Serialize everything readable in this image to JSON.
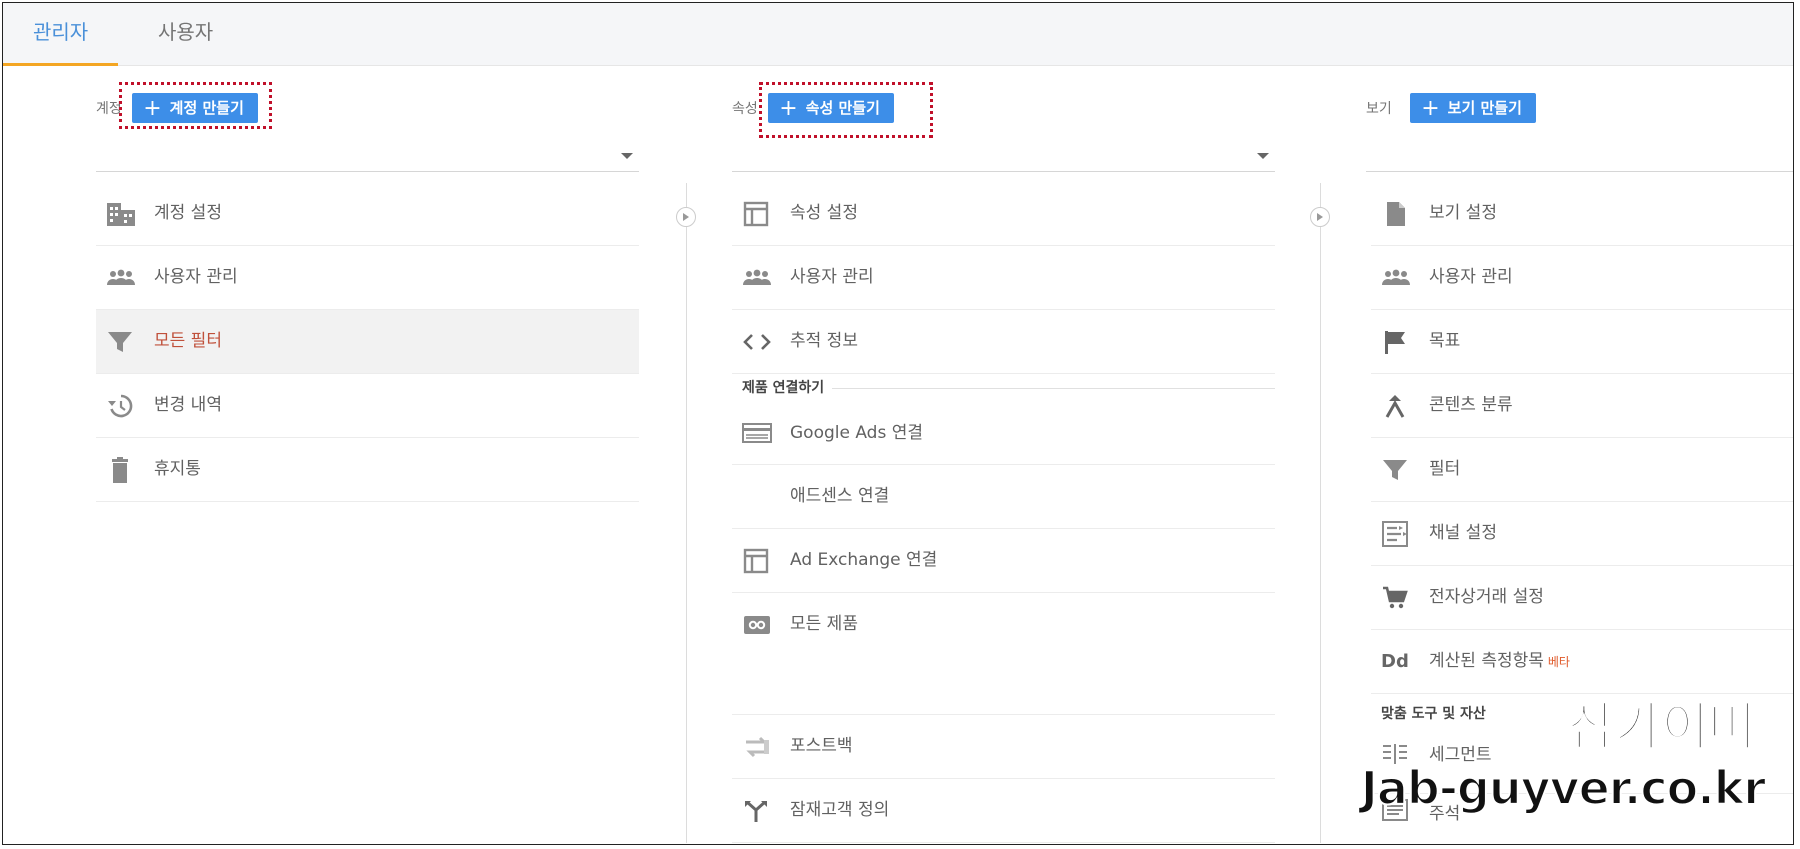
{
  "tabs": [
    {
      "label": "관리자",
      "active": true
    },
    {
      "label": "사용자",
      "active": false
    }
  ],
  "account": {
    "label": "계정",
    "create_button": "계정 만들기",
    "items": [
      {
        "label": "계정 설정",
        "icon": "building-icon"
      },
      {
        "label": "사용자 관리",
        "icon": "people-icon"
      },
      {
        "label": "모든 필터",
        "icon": "filter-icon",
        "selected": true
      },
      {
        "label": "변경 내역",
        "icon": "history-icon"
      },
      {
        "label": "휴지통",
        "icon": "trash-icon"
      }
    ]
  },
  "property": {
    "label": "속성",
    "create_button": "속성 만들기",
    "items": [
      {
        "label": "속성 설정",
        "icon": "window-icon"
      },
      {
        "label": "사용자 관리",
        "icon": "people-icon"
      },
      {
        "label": "추적 정보",
        "icon": "code-icon"
      }
    ],
    "section_title": "제품 연결하기",
    "product_items": [
      {
        "label": "Google Ads 연결",
        "icon": "ads-card-icon"
      },
      {
        "label": "애드센스 연결",
        "icon": ""
      },
      {
        "label": "Ad Exchange 연결",
        "icon": "window-icon"
      },
      {
        "label": "모든 제품",
        "icon": "link-icon"
      }
    ],
    "more_items": [
      {
        "label": "포스트백",
        "icon": "postback-icon"
      },
      {
        "label": "잠재고객 정의",
        "icon": "audience-icon"
      }
    ]
  },
  "view": {
    "label": "보기",
    "create_button": "보기 만들기",
    "items": [
      {
        "label": "보기 설정",
        "icon": "document-icon"
      },
      {
        "label": "사용자 관리",
        "icon": "people-icon"
      },
      {
        "label": "목표",
        "icon": "flag-icon"
      },
      {
        "label": "콘텐츠 분류",
        "icon": "grouping-icon"
      },
      {
        "label": "필터",
        "icon": "filter-icon"
      },
      {
        "label": "채널 설정",
        "icon": "channel-icon"
      },
      {
        "label": "전자상거래 설정",
        "icon": "cart-icon"
      },
      {
        "label": "계산된 측정항목",
        "icon": "dd-icon",
        "badge": "베타"
      }
    ],
    "section_title": "맞춤 도구 및 자산",
    "tool_items": [
      {
        "label": "세그먼트",
        "icon": "segment-icon"
      },
      {
        "label": "주석",
        "icon": "annotation-icon"
      }
    ]
  },
  "watermark": {
    "line1": "잡가이버",
    "line2": "Jab-guyver.co.kr"
  },
  "colors": {
    "accent_blue": "#3d8ee8",
    "tab_active": "#4a90d9",
    "tab_underline": "#f4a623",
    "selected_text": "#c0503a",
    "highlight_box": "#c0102a"
  }
}
